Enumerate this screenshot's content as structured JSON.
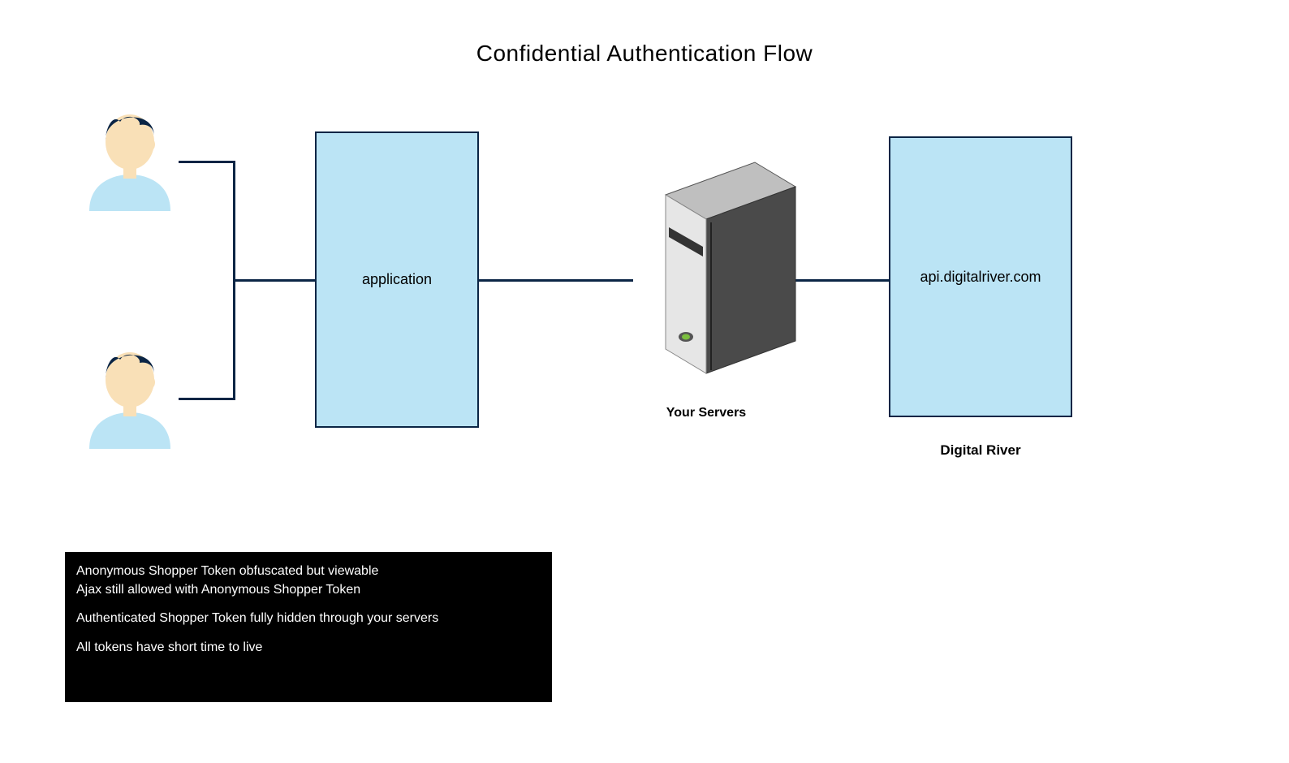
{
  "title": "Confidential Authentication Flow",
  "nodes": {
    "application": "application",
    "api": "api.digitalriver.com"
  },
  "labels": {
    "your_servers": "Your Servers",
    "digital_river": "Digital River"
  },
  "notes": {
    "line1": "Anonymous Shopper Token obfuscated but viewable",
    "line2": "Ajax still allowed with Anonymous Shopper Token",
    "line3": "Authenticated Shopper Token fully hidden through your servers",
    "line4": "All tokens have short time to live"
  },
  "colors": {
    "box_fill": "#BBE4F5",
    "box_stroke": "#0B2545",
    "hair": "#0B2545",
    "skin": "#F9E0B7",
    "shirt": "#BBE4F5"
  }
}
